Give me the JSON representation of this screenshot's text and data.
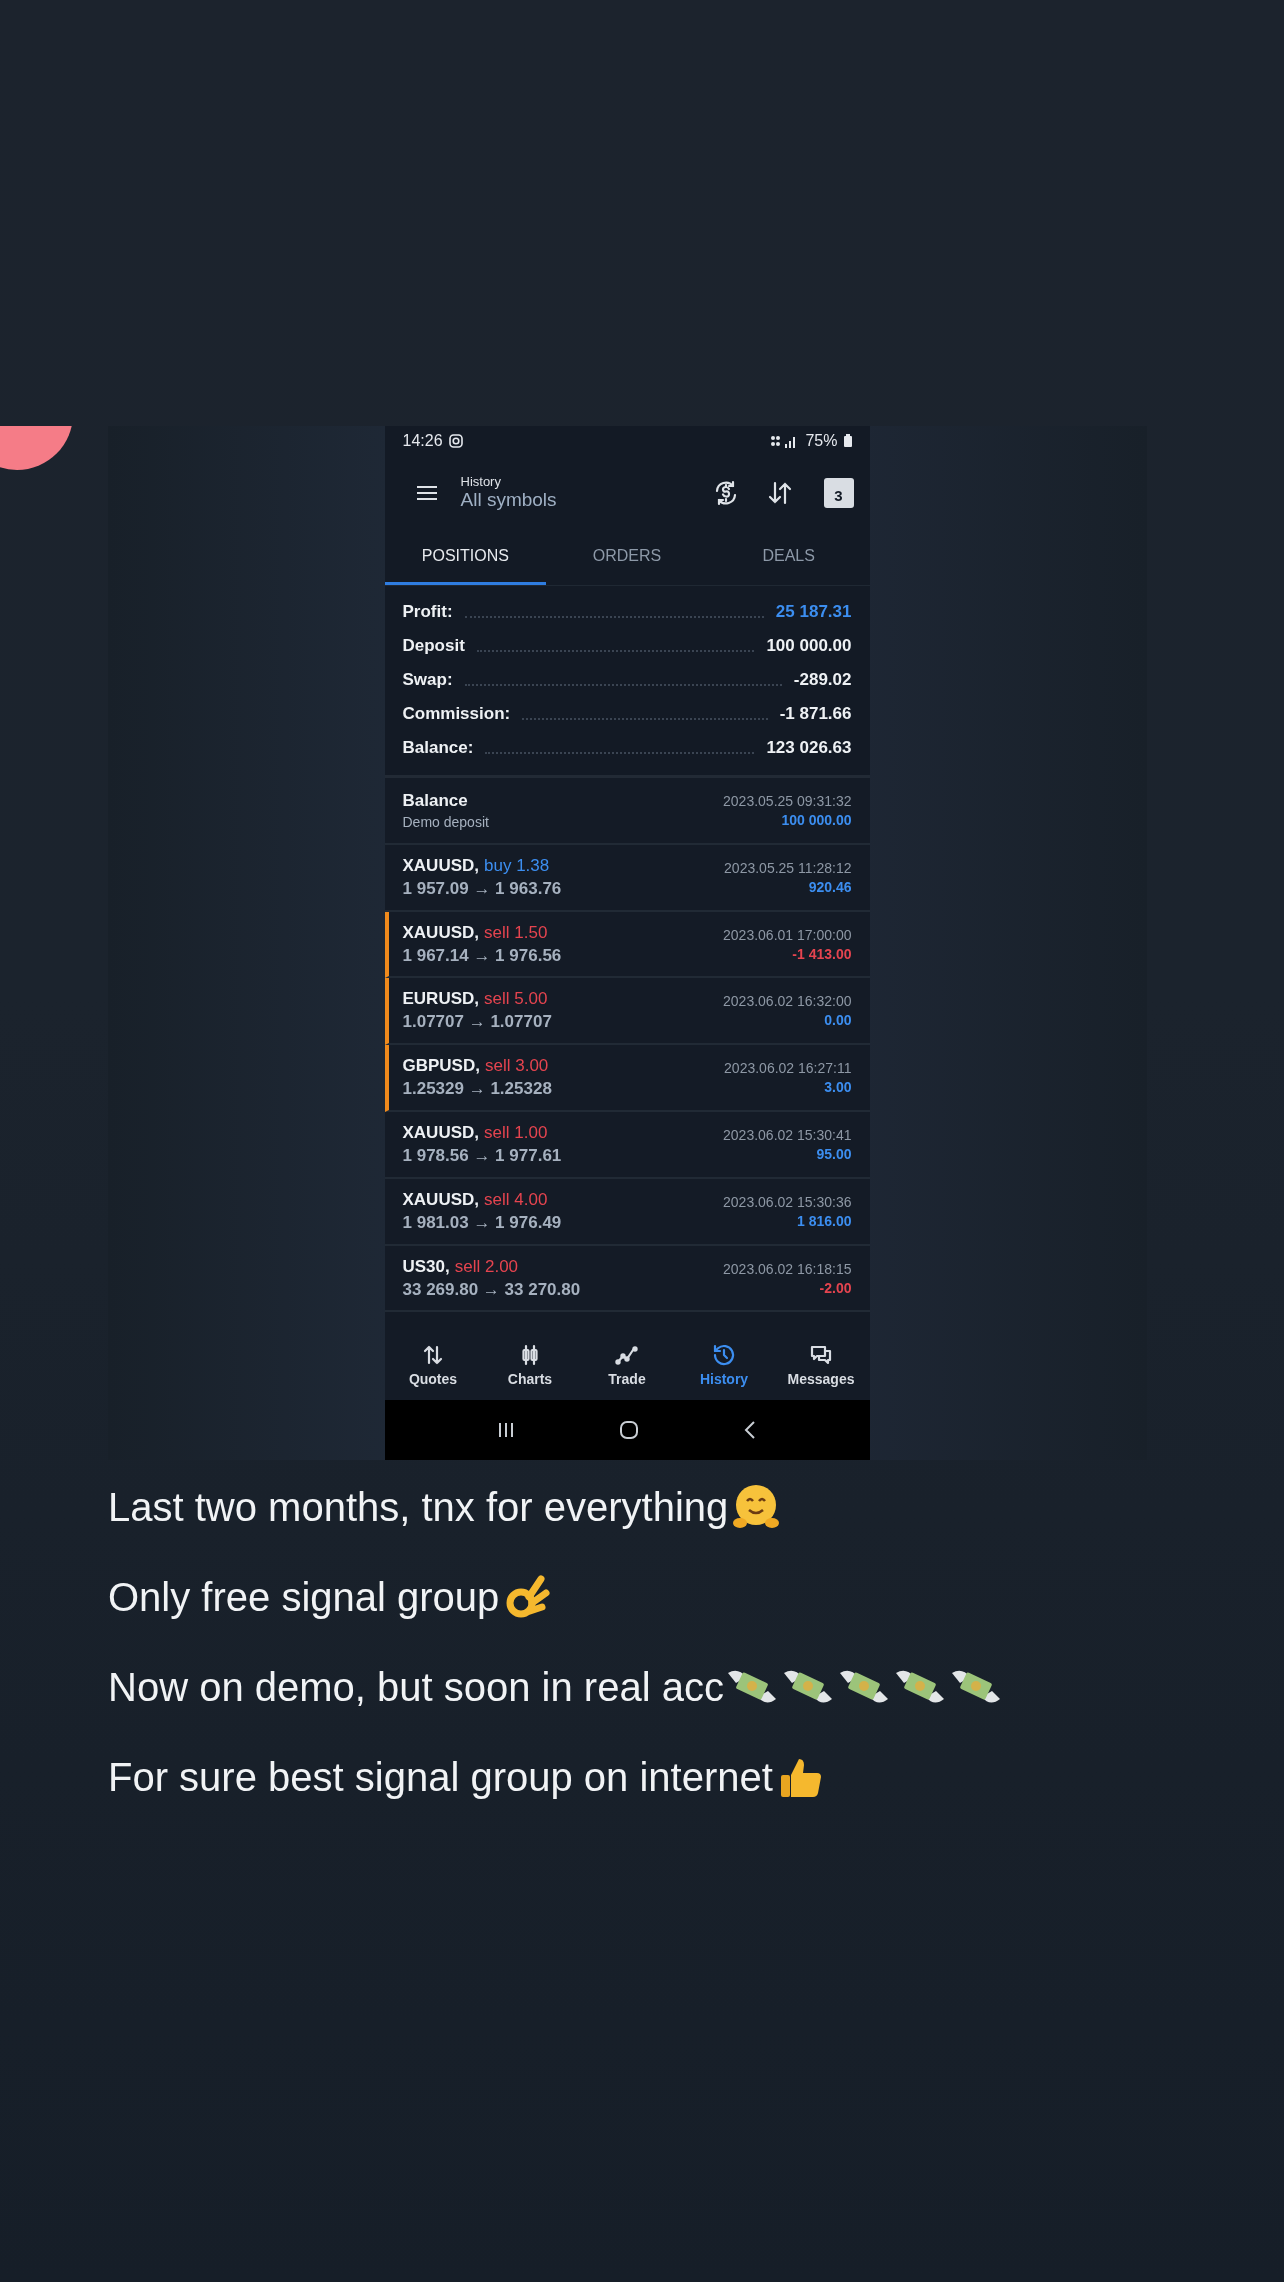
{
  "phone": {
    "status_bar": {
      "time": "14:26",
      "battery": "75%"
    },
    "header": {
      "title": "History",
      "subtitle": "All symbols",
      "calendar_day": "3"
    },
    "tabs": [
      {
        "label": "POSITIONS",
        "selected": true
      },
      {
        "label": "ORDERS",
        "selected": false
      },
      {
        "label": "DEALS",
        "selected": false
      }
    ],
    "summary": [
      {
        "label": "Profit:",
        "value": {
          "text": "25 187.31",
          "color": "#3c8ef0"
        }
      },
      {
        "label": "Deposit",
        "value": {
          "text": "100 000.00",
          "color": "#eef1f4"
        }
      },
      {
        "label": "Swap:",
        "value": {
          "text": "-289.02",
          "color": "#eef1f4"
        }
      },
      {
        "label": "Commission:",
        "value": {
          "text": "-1 871.66",
          "color": "#eef1f4"
        }
      },
      {
        "label": "Balance:",
        "value": {
          "text": "123 026.63",
          "color": "#eef1f4"
        }
      }
    ],
    "positions": [
      {
        "kind": "balance",
        "title": "Balance",
        "detail": "Demo deposit",
        "time": "2023.05.25 09:31:32",
        "amount": {
          "text": "100 000.00",
          "color": "#3c8ef0"
        },
        "marked": false
      },
      {
        "kind": "trade",
        "title": "XAUUSD,",
        "volume": {
          "text": "buy 1.38",
          "color": "#3c8ef0"
        },
        "detail": "1 957.09 → 1 963.76",
        "time": "2023.05.25 11:28:12",
        "amount": {
          "text": "920.46",
          "color": "#3c8ef0"
        },
        "marked": false
      },
      {
        "kind": "trade",
        "title": "XAUUSD,",
        "volume": {
          "text": "sell 1.50",
          "color": "#e5444f"
        },
        "detail": "1 967.14 → 1 976.56",
        "time": "2023.06.01 17:00:00",
        "amount": {
          "text": "-1 413.00",
          "color": "#e5444f"
        },
        "marked": true
      },
      {
        "kind": "trade",
        "title": "EURUSD,",
        "volume": {
          "text": "sell 5.00",
          "color": "#e5444f"
        },
        "detail": "1.07707 → 1.07707",
        "time": "2023.06.02 16:32:00",
        "amount": {
          "text": "0.00",
          "color": "#3c8ef0"
        },
        "marked": true
      },
      {
        "kind": "trade",
        "title": "GBPUSD,",
        "volume": {
          "text": "sell 3.00",
          "color": "#e5444f"
        },
        "detail": "1.25329 → 1.25328",
        "time": "2023.06.02 16:27:11",
        "amount": {
          "text": "3.00",
          "color": "#3c8ef0"
        },
        "marked": true
      },
      {
        "kind": "trade",
        "title": "XAUUSD,",
        "volume": {
          "text": "sell 1.00",
          "color": "#e5444f"
        },
        "detail": "1 978.56 → 1 977.61",
        "time": "2023.06.02 15:30:41",
        "amount": {
          "text": "95.00",
          "color": "#3c8ef0"
        },
        "marked": false
      },
      {
        "kind": "trade",
        "title": "XAUUSD,",
        "volume": {
          "text": "sell 4.00",
          "color": "#e5444f"
        },
        "detail": "1 981.03 → 1 976.49",
        "time": "2023.06.02 15:30:36",
        "amount": {
          "text": "1 816.00",
          "color": "#3c8ef0"
        },
        "marked": false
      },
      {
        "kind": "trade",
        "title": "US30,",
        "volume": {
          "text": "sell 2.00",
          "color": "#e5444f"
        },
        "detail": "33 269.80 → 33 270.80",
        "time": "2023.06.02 16:18:15",
        "amount": {
          "text": "-2.00",
          "color": "#e5444f"
        },
        "marked": false
      }
    ],
    "bottom_nav": [
      {
        "label": "Quotes",
        "kind": "quotes",
        "selected": false
      },
      {
        "label": "Charts",
        "kind": "charts",
        "selected": false
      },
      {
        "label": "Trade",
        "kind": "trade",
        "selected": false
      },
      {
        "label": "History",
        "kind": "history",
        "selected": true
      },
      {
        "label": "Messages",
        "kind": "messages",
        "selected": false
      }
    ]
  },
  "message": [
    {
      "text": "Last two months, tnx for everything",
      "emojis": [
        {
          "kind": "hug"
        }
      ]
    },
    {
      "text": "Only free signal group",
      "emojis": [
        {
          "kind": "ok"
        }
      ]
    },
    {
      "text": "Now on demo, but soon in real acc",
      "emojis": [
        {
          "kind": "money"
        },
        {
          "kind": "money"
        },
        {
          "kind": "money"
        },
        {
          "kind": "money"
        },
        {
          "kind": "money"
        }
      ]
    },
    {
      "text": "For sure best signal group on internet",
      "emojis": [
        {
          "kind": "thumbs"
        }
      ]
    }
  ]
}
